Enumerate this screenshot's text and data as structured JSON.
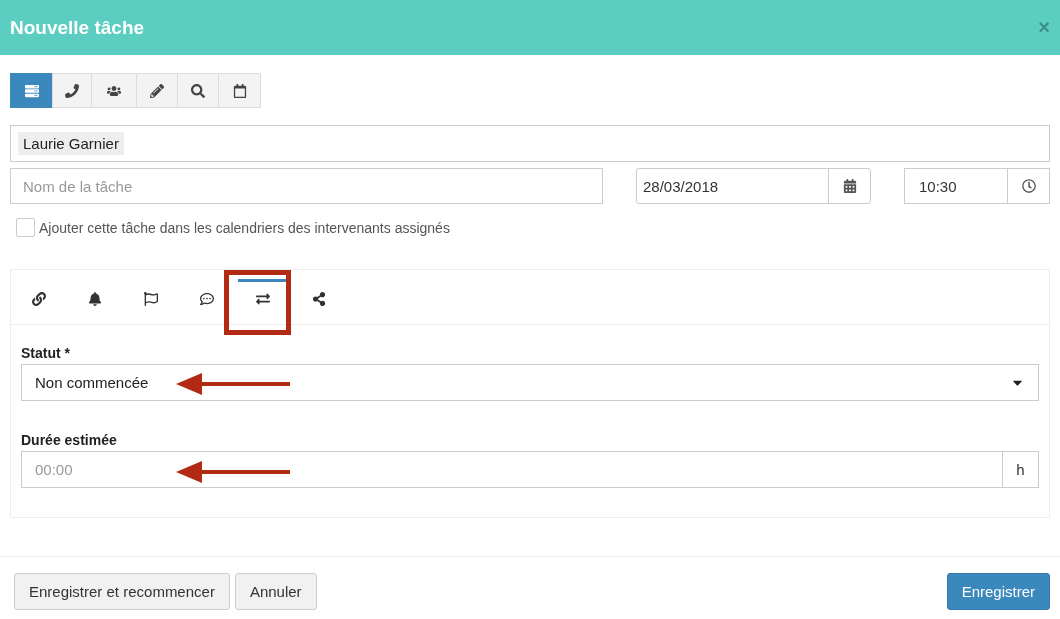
{
  "dialog": {
    "title": "Nouvelle tâche",
    "close": "×"
  },
  "toolbar": [
    {
      "selected": true
    },
    {
      "selected": false
    },
    {
      "selected": false
    },
    {
      "selected": false
    },
    {
      "selected": false
    },
    {
      "selected": false
    }
  ],
  "assignees": [
    "Laurie Garnier"
  ],
  "task_name": {
    "placeholder": "Nom de la tâche"
  },
  "date": {
    "value": "28/03/2018"
  },
  "time": {
    "value": "10:30"
  },
  "calendar_option": {
    "label": "Ajouter cette tâche dans les calendriers des intervenants assignés",
    "checked": false
  },
  "tabs": [
    {
      "selected": false
    },
    {
      "selected": false
    },
    {
      "selected": false
    },
    {
      "selected": false
    },
    {
      "selected": true
    },
    {
      "selected": false
    }
  ],
  "status": {
    "label": "Statut *",
    "value": "Non commencée"
  },
  "duration": {
    "label": "Durée estimée",
    "placeholder": "00:00",
    "unit": "h"
  },
  "buttons": [
    {
      "label": "Enregistrer et recommencer",
      "kind": "secondary"
    },
    {
      "label": "Annuler",
      "kind": "secondary"
    },
    {
      "label": "Enregistrer",
      "kind": "primary"
    }
  ]
}
